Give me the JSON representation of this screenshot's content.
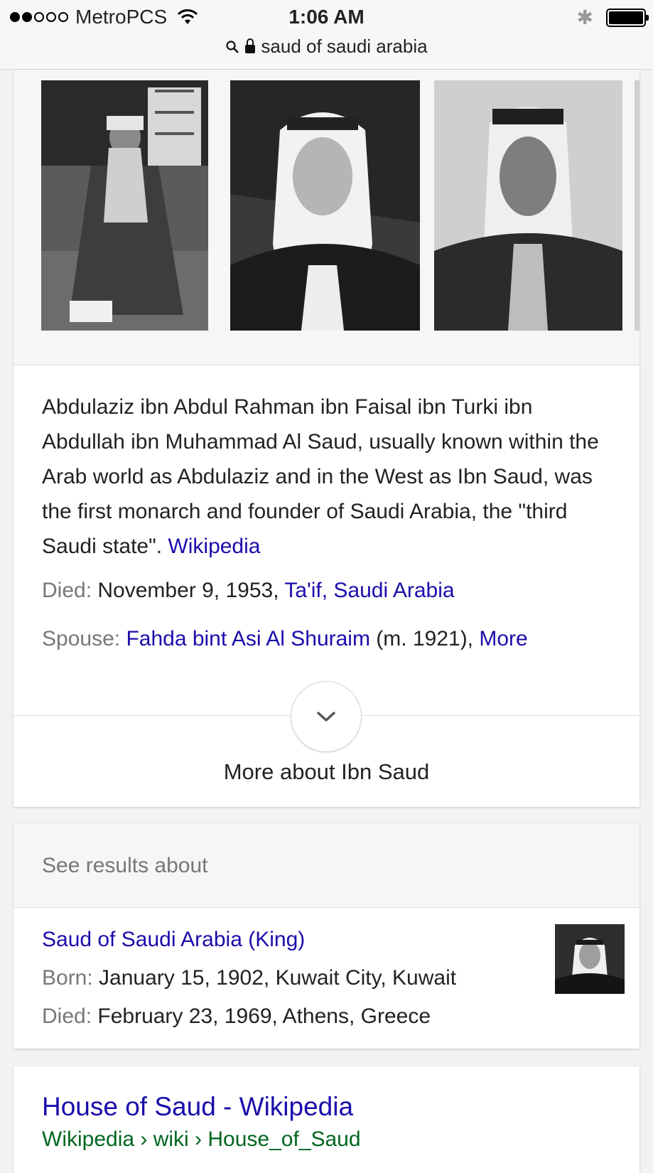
{
  "status_bar": {
    "carrier": "MetroPCS",
    "time": "1:06 AM",
    "url": "saud of saudi arabia"
  },
  "knowledge_panel": {
    "description": "Abdulaziz ibn Abdul Rahman ibn Faisal ibn Turki ibn Abdullah ibn Muhammad Al Saud, usually known within the Arab world as Abdulaziz and in the West as Ibn Saud, was the first monarch and founder of Saudi Arabia, the \"third Saudi state\". ",
    "source_link": "Wikipedia",
    "died_label": "Died:",
    "died_value": " November 9, 1953, ",
    "died_place": "Ta'if, Saudi Arabia",
    "spouse_label": "Spouse:",
    "spouse_name": "Fahda bint Asi Al Shuraim",
    "spouse_years": " (m. 1921), ",
    "spouse_more": "More",
    "more_about": "More about Ibn Saud"
  },
  "see_results": {
    "heading": "See results about",
    "title": "Saud of Saudi Arabia (King)",
    "born_label": "Born:",
    "born_value": " January 15, 1902, Kuwait City, Kuwait",
    "died_label": "Died:",
    "died_value": " February 23, 1969, Athens, Greece"
  },
  "web_result": {
    "title": "House of Saud - Wikipedia",
    "url": "Wikipedia › wiki › House_of_Saud"
  },
  "colors": {
    "link": "#1a0dab",
    "url_green": "#006621",
    "label_gray": "#777777"
  }
}
